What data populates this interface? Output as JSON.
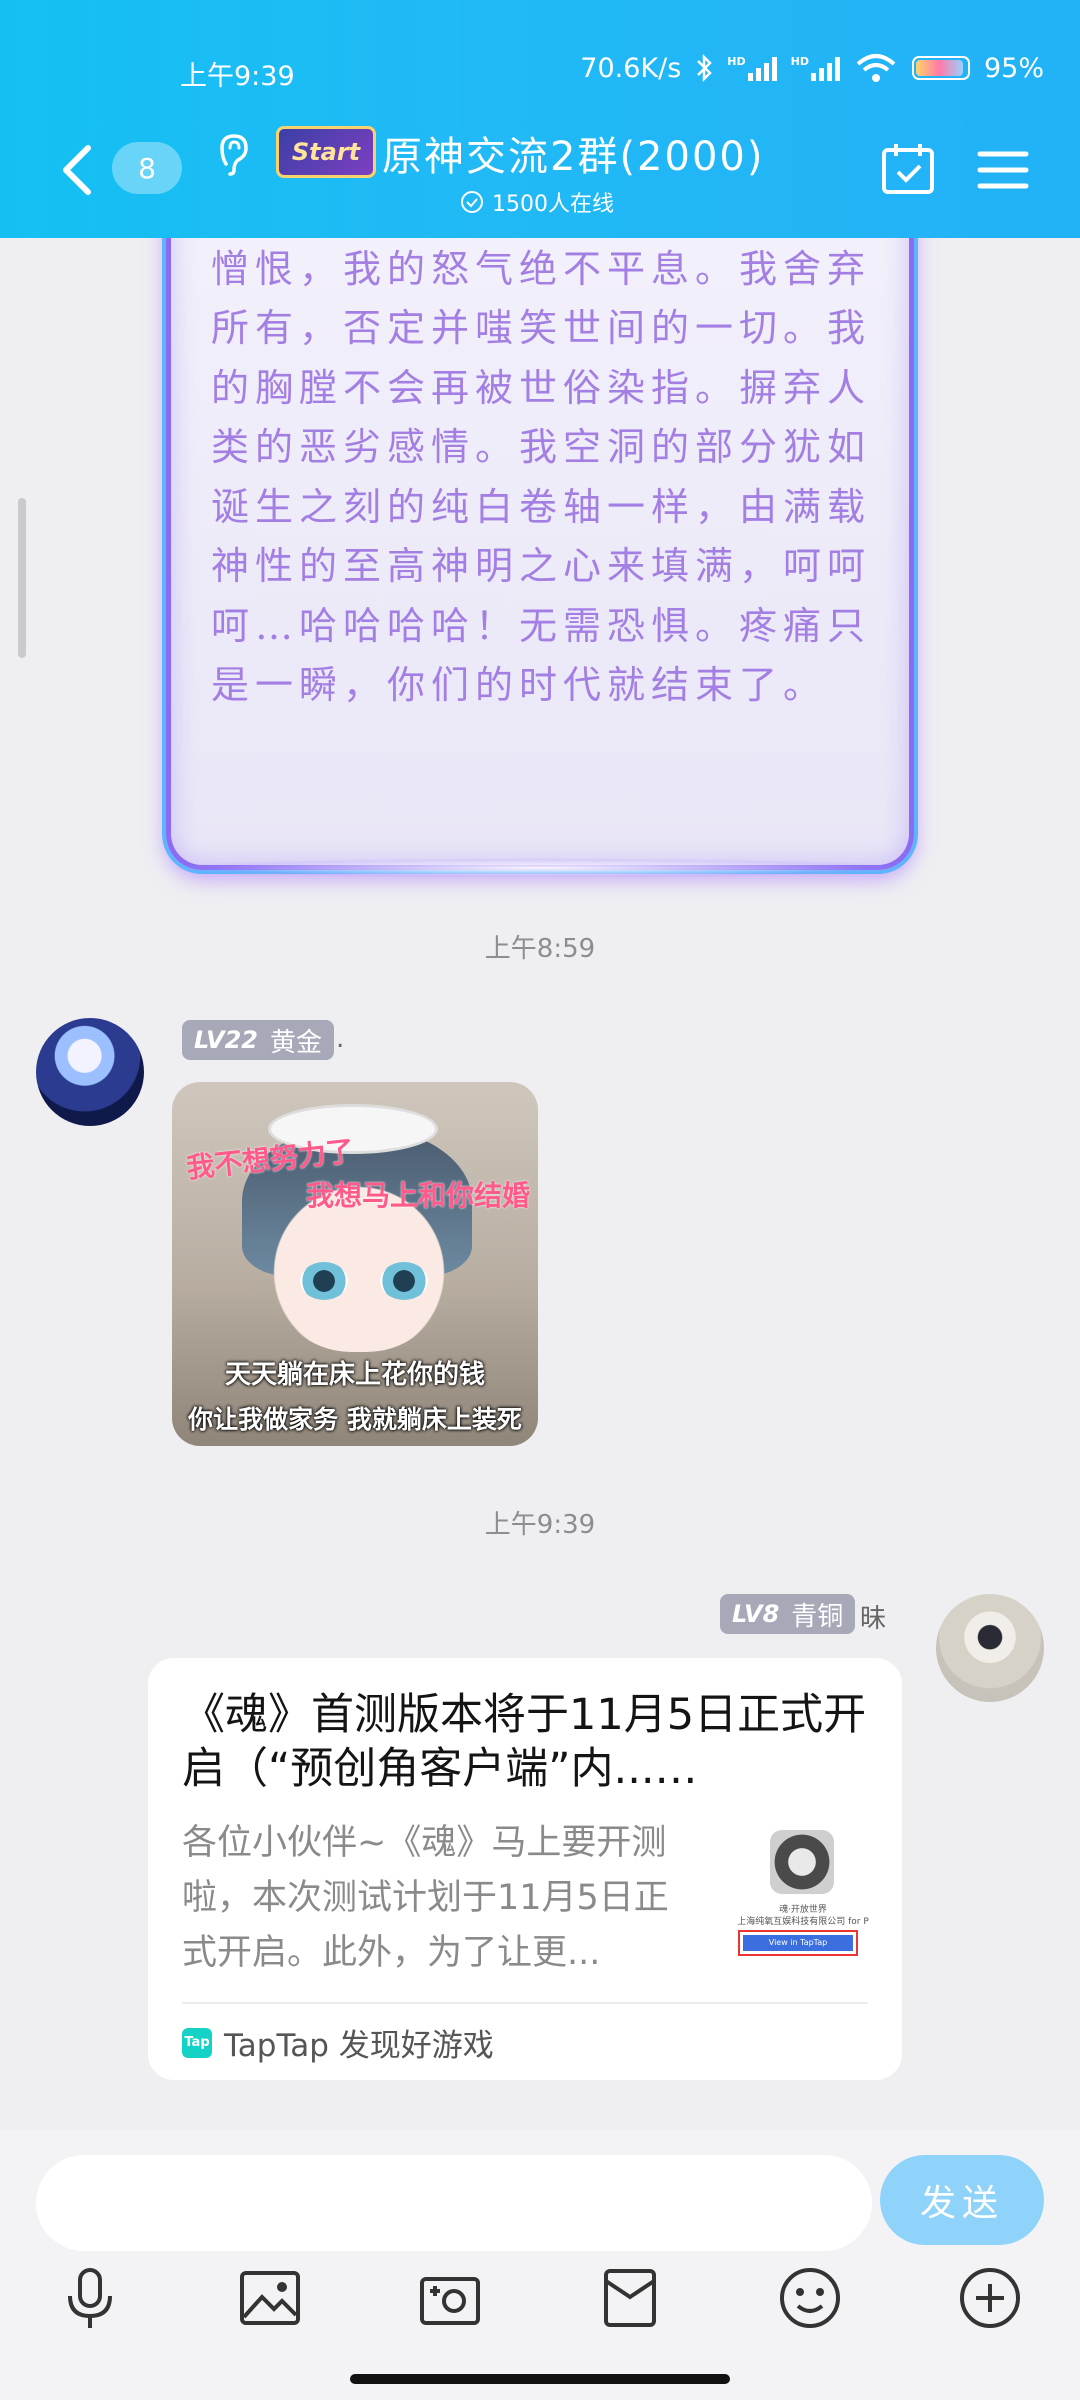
{
  "status_bar": {
    "time": "上午9:39",
    "network_speed": "70.6K/s",
    "signal_label_1": "HD",
    "signal_label_2": "HD",
    "battery": "95%"
  },
  "header": {
    "unread_count": "8",
    "group_logo_text": "Start",
    "group_name": "原神交流2群(2000)",
    "online_count": "1500人在线"
  },
  "messages": {
    "quote_text": "与我的约定，人绝不信，神亦令我憎恨，我的怒气绝不平息。我舍弃所有，否定并嗤笑世间的一切。我的胸膛不会再被世俗染指。摒弃人类的恶劣感情。我空洞的部分犹如诞生之刻的纯白卷轴一样，由满载神性的至高神明之心来填满，呵呵呵…哈哈哈哈！无需恐惧。疼痛只是一瞬，你们的时代就结束了。",
    "timestamp_1": "上午8:59",
    "sender_1": {
      "level": "LV22",
      "rank": "黄金",
      "name": "."
    },
    "sticker": {
      "top_text_1": "我不想努力了",
      "top_text_2": "我想马上和你结婚",
      "bottom_text_1": "天天躺在床上花你的钱",
      "bottom_text_2": "你让我做家务 我就躺床上装死"
    },
    "timestamp_2": "上午9:39",
    "sender_2": {
      "level": "LV8",
      "rank": "青铜",
      "name": "昧"
    },
    "link_card": {
      "title": "《魂》首测版本将于11月5日正式开启（“预创角客户端”内...…",
      "description": "各位小伙伴~《魂》马上要开测啦，本次测试计划于11月5日正式开启。此外，为了让更...",
      "thumb_line_1": "魂·开放世界",
      "thumb_line_2": "上海纯氧互娱科技有限公司 for P",
      "thumb_button": "View in TapTap",
      "source_icon": "Tap",
      "source": "TapTap 发现好游戏"
    }
  },
  "input": {
    "placeholder": "",
    "send_label": "发送"
  },
  "colors": {
    "header": "#21b9f6",
    "send_button": "#8fd3fb",
    "quote_text": "#a47fe3",
    "level_badge": "#a7a9b9"
  }
}
